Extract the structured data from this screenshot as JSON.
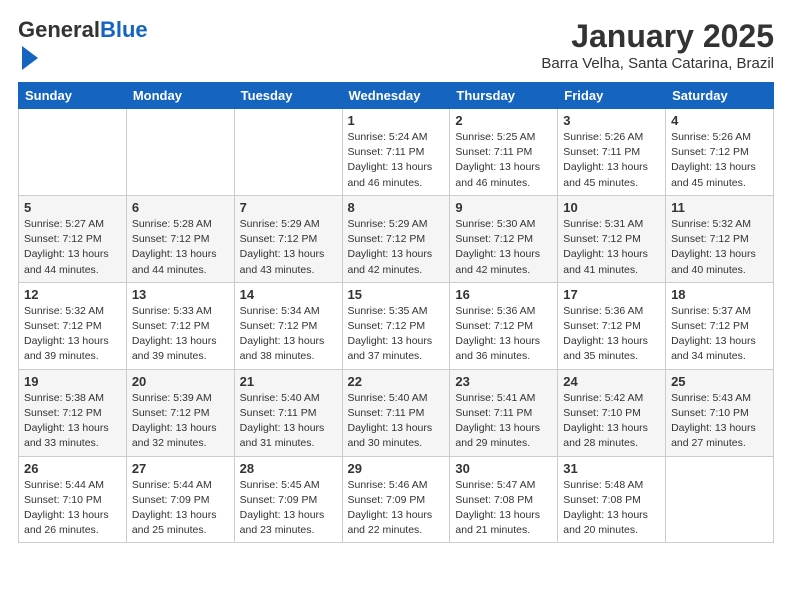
{
  "header": {
    "logo_general": "General",
    "logo_blue": "Blue",
    "title": "January 2025",
    "location": "Barra Velha, Santa Catarina, Brazil"
  },
  "weekdays": [
    "Sunday",
    "Monday",
    "Tuesday",
    "Wednesday",
    "Thursday",
    "Friday",
    "Saturday"
  ],
  "weeks": [
    [
      {
        "day": "",
        "detail": ""
      },
      {
        "day": "",
        "detail": ""
      },
      {
        "day": "",
        "detail": ""
      },
      {
        "day": "1",
        "detail": "Sunrise: 5:24 AM\nSunset: 7:11 PM\nDaylight: 13 hours\nand 46 minutes."
      },
      {
        "day": "2",
        "detail": "Sunrise: 5:25 AM\nSunset: 7:11 PM\nDaylight: 13 hours\nand 46 minutes."
      },
      {
        "day": "3",
        "detail": "Sunrise: 5:26 AM\nSunset: 7:11 PM\nDaylight: 13 hours\nand 45 minutes."
      },
      {
        "day": "4",
        "detail": "Sunrise: 5:26 AM\nSunset: 7:12 PM\nDaylight: 13 hours\nand 45 minutes."
      }
    ],
    [
      {
        "day": "5",
        "detail": "Sunrise: 5:27 AM\nSunset: 7:12 PM\nDaylight: 13 hours\nand 44 minutes."
      },
      {
        "day": "6",
        "detail": "Sunrise: 5:28 AM\nSunset: 7:12 PM\nDaylight: 13 hours\nand 44 minutes."
      },
      {
        "day": "7",
        "detail": "Sunrise: 5:29 AM\nSunset: 7:12 PM\nDaylight: 13 hours\nand 43 minutes."
      },
      {
        "day": "8",
        "detail": "Sunrise: 5:29 AM\nSunset: 7:12 PM\nDaylight: 13 hours\nand 42 minutes."
      },
      {
        "day": "9",
        "detail": "Sunrise: 5:30 AM\nSunset: 7:12 PM\nDaylight: 13 hours\nand 42 minutes."
      },
      {
        "day": "10",
        "detail": "Sunrise: 5:31 AM\nSunset: 7:12 PM\nDaylight: 13 hours\nand 41 minutes."
      },
      {
        "day": "11",
        "detail": "Sunrise: 5:32 AM\nSunset: 7:12 PM\nDaylight: 13 hours\nand 40 minutes."
      }
    ],
    [
      {
        "day": "12",
        "detail": "Sunrise: 5:32 AM\nSunset: 7:12 PM\nDaylight: 13 hours\nand 39 minutes."
      },
      {
        "day": "13",
        "detail": "Sunrise: 5:33 AM\nSunset: 7:12 PM\nDaylight: 13 hours\nand 39 minutes."
      },
      {
        "day": "14",
        "detail": "Sunrise: 5:34 AM\nSunset: 7:12 PM\nDaylight: 13 hours\nand 38 minutes."
      },
      {
        "day": "15",
        "detail": "Sunrise: 5:35 AM\nSunset: 7:12 PM\nDaylight: 13 hours\nand 37 minutes."
      },
      {
        "day": "16",
        "detail": "Sunrise: 5:36 AM\nSunset: 7:12 PM\nDaylight: 13 hours\nand 36 minutes."
      },
      {
        "day": "17",
        "detail": "Sunrise: 5:36 AM\nSunset: 7:12 PM\nDaylight: 13 hours\nand 35 minutes."
      },
      {
        "day": "18",
        "detail": "Sunrise: 5:37 AM\nSunset: 7:12 PM\nDaylight: 13 hours\nand 34 minutes."
      }
    ],
    [
      {
        "day": "19",
        "detail": "Sunrise: 5:38 AM\nSunset: 7:12 PM\nDaylight: 13 hours\nand 33 minutes."
      },
      {
        "day": "20",
        "detail": "Sunrise: 5:39 AM\nSunset: 7:12 PM\nDaylight: 13 hours\nand 32 minutes."
      },
      {
        "day": "21",
        "detail": "Sunrise: 5:40 AM\nSunset: 7:11 PM\nDaylight: 13 hours\nand 31 minutes."
      },
      {
        "day": "22",
        "detail": "Sunrise: 5:40 AM\nSunset: 7:11 PM\nDaylight: 13 hours\nand 30 minutes."
      },
      {
        "day": "23",
        "detail": "Sunrise: 5:41 AM\nSunset: 7:11 PM\nDaylight: 13 hours\nand 29 minutes."
      },
      {
        "day": "24",
        "detail": "Sunrise: 5:42 AM\nSunset: 7:10 PM\nDaylight: 13 hours\nand 28 minutes."
      },
      {
        "day": "25",
        "detail": "Sunrise: 5:43 AM\nSunset: 7:10 PM\nDaylight: 13 hours\nand 27 minutes."
      }
    ],
    [
      {
        "day": "26",
        "detail": "Sunrise: 5:44 AM\nSunset: 7:10 PM\nDaylight: 13 hours\nand 26 minutes."
      },
      {
        "day": "27",
        "detail": "Sunrise: 5:44 AM\nSunset: 7:09 PM\nDaylight: 13 hours\nand 25 minutes."
      },
      {
        "day": "28",
        "detail": "Sunrise: 5:45 AM\nSunset: 7:09 PM\nDaylight: 13 hours\nand 23 minutes."
      },
      {
        "day": "29",
        "detail": "Sunrise: 5:46 AM\nSunset: 7:09 PM\nDaylight: 13 hours\nand 22 minutes."
      },
      {
        "day": "30",
        "detail": "Sunrise: 5:47 AM\nSunset: 7:08 PM\nDaylight: 13 hours\nand 21 minutes."
      },
      {
        "day": "31",
        "detail": "Sunrise: 5:48 AM\nSunset: 7:08 PM\nDaylight: 13 hours\nand 20 minutes."
      },
      {
        "day": "",
        "detail": ""
      }
    ]
  ]
}
